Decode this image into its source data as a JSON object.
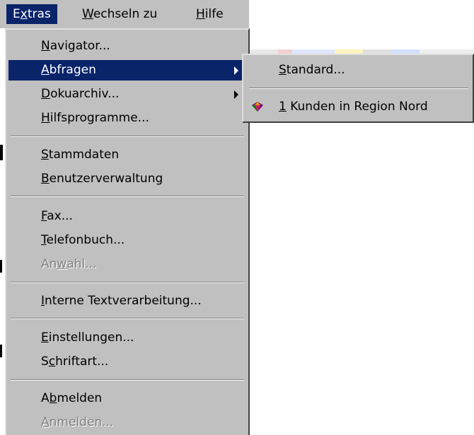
{
  "menubar": {
    "items": [
      {
        "pre": "E",
        "u": "x",
        "post": "tras"
      },
      {
        "pre": "",
        "u": "W",
        "post": "echseln zu"
      },
      {
        "pre": "",
        "u": "H",
        "post": "ilfe"
      }
    ]
  },
  "extras_menu": {
    "items": [
      {
        "pre": "",
        "u": "N",
        "post": "avigator..."
      },
      {
        "pre": "",
        "u": "A",
        "post": "bfragen"
      },
      {
        "pre": "",
        "u": "D",
        "post": "okuarchiv..."
      },
      {
        "pre": "",
        "u": "H",
        "post": "ilfsprogramme..."
      },
      {
        "pre": "",
        "u": "S",
        "post": "tammdaten"
      },
      {
        "pre": "",
        "u": "B",
        "post": "enutzerverwaltung"
      },
      {
        "pre": "",
        "u": "F",
        "post": "ax..."
      },
      {
        "pre": "",
        "u": "T",
        "post": "elefonbuch..."
      },
      {
        "pre": "An",
        "u": "w",
        "post": "ahl..."
      },
      {
        "pre": "",
        "u": "I",
        "post": "nterne Textverarbeitung..."
      },
      {
        "pre": "",
        "u": "E",
        "post": "instellungen..."
      },
      {
        "pre": "S",
        "u": "c",
        "post": "hriftart..."
      },
      {
        "pre": "A",
        "u": "b",
        "post": "melden"
      },
      {
        "pre": "",
        "u": "A",
        "post": "nmelden..."
      }
    ]
  },
  "abfragen_submenu": {
    "items": [
      {
        "pre": "",
        "u": "S",
        "post": "tandard..."
      },
      {
        "pre": "",
        "u": "1",
        "post": " Kunden in Region Nord"
      }
    ]
  },
  "icons": {
    "submenu_arrow": "triangle-right-icon",
    "query_item": "gem-icon"
  },
  "colors": {
    "menu_face": "#c0c0c0",
    "highlight": "#0a246a",
    "highlight_text": "#ffffff",
    "disabled_text": "#808080"
  }
}
